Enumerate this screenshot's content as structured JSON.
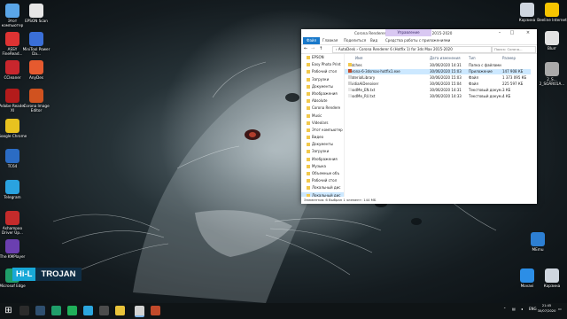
{
  "desktop_icons_left": [
    {
      "label": "Этот компьютер",
      "color": "#5aa6e8"
    },
    {
      "label": "EPSON Scan",
      "color": "#e7e7e7"
    },
    {
      "label": "ASSY FineRead...",
      "color": "#d33"
    },
    {
      "label": "MiniTool Power Da...",
      "color": "#3a6fd8"
    },
    {
      "label": "CCleaner",
      "color": "#c8262d"
    },
    {
      "label": "AnyDes",
      "color": "#e65a2f"
    },
    {
      "label": "Adobe Reader XI",
      "color": "#b31b1b"
    },
    {
      "label": "Corona Image Editor",
      "color": "#d0521f"
    },
    {
      "label": "Google Chrome",
      "color": "#e8c21f"
    },
    {
      "label": "TC64",
      "color": "#2b6cc4"
    },
    {
      "label": "Telegram",
      "color": "#2aa3e0"
    },
    {
      "label": "Ashampoo Driver Up...",
      "color": "#c42b2b"
    },
    {
      "label": "The KMPlayer",
      "color": "#6b3fb0"
    },
    {
      "label": "Microsof Edge",
      "color": "#1f9e6a"
    }
  ],
  "desktop_icons_right": [
    {
      "label": "Корзина",
      "color": "#cfd6df"
    },
    {
      "label": "Beeline Internet",
      "color": "#f5c400"
    },
    {
      "label": "Topaz A...",
      "color": "#d9d9d9"
    },
    {
      "label": "Blurr",
      "color": "#e2e2e2"
    },
    {
      "label": "2_S... 2_SOAR01A...",
      "color": "#aaaaaa"
    },
    {
      "label": "MEmu",
      "color": "#2d7fd3"
    },
    {
      "label": "Movavi",
      "color": "#2c8ee6"
    },
    {
      "label": "Корзина",
      "color": "#cfd6df"
    }
  ],
  "window": {
    "title": "Corona Renderer 6 (Hotfix 1) for 3ds Max 2015-2020",
    "context_tab": "Управление",
    "ribbon_tabs": [
      "Файл",
      "Главная",
      "Поделиться",
      "Вид",
      "Средства работы с приложениями"
    ],
    "address": "›  AutoDesk  ›  Corona Renderer 6 (Hotfix 1) for 3ds Max 2015-2020",
    "search_placeholder": "Поиск: Corona...",
    "nav_items": [
      "EPSON",
      "Easy Photo Print",
      "Рабочий стол",
      "Загрузки",
      "Документы",
      "Изображения",
      "Absolute",
      "Corona Rendere",
      "Music",
      "Videolars",
      "Этот компьютер",
      "Видео",
      "Документы",
      "Загрузки",
      "Изображения",
      "Музыка",
      "Объемные объ",
      "Рабочий стол",
      "Локальный дис",
      "Локальный дис"
    ],
    "quick_access": [
      "Photo Print"
    ],
    "columns": [
      "Имя",
      "Дата изменения",
      "Тип",
      "Размер"
    ],
    "files": [
      {
        "name": "Patches",
        "date": "30/06/2020 14:31",
        "type": "Папка с файлами",
        "size": "",
        "icon": "folder"
      },
      {
        "name": "corona-6-3dsmax-hotfix1.exe",
        "date": "30/06/2020 15:03",
        "type": "Приложение",
        "size": "147 908 КБ",
        "icon": "exe"
      },
      {
        "name": "MaterialLibrary",
        "date": "30/06/2020 15:03",
        "type": "Файл",
        "size": "1 373 095 КБ",
        "icon": "file"
      },
      {
        "name": "NvidiaAiDenoiser",
        "date": "30/06/2020 15:04",
        "type": "Файл",
        "size": "225 597 КБ",
        "icon": "file"
      },
      {
        "name": "ReadMe_EN.txt",
        "date": "30/06/2020 14:31",
        "type": "Текстовый докум...",
        "size": "3 КБ",
        "icon": "txt"
      },
      {
        "name": "ReadMe_RU.txt",
        "date": "30/06/2020 14:33",
        "type": "Текстовый докум...",
        "size": "4 КБ",
        "icon": "txt"
      }
    ],
    "status": "Элементов: 6    Выбран 1 элемент: 144 МБ"
  },
  "brand": {
    "left": "Hi-L",
    "right": "TROJAN"
  },
  "tray": {
    "lang": "ENG",
    "time": "21:45",
    "date": "30/07/2020"
  },
  "colors": {
    "accent": "#1979ca",
    "selection": "#cce8ff",
    "context_tab": "#d9c8f2"
  }
}
